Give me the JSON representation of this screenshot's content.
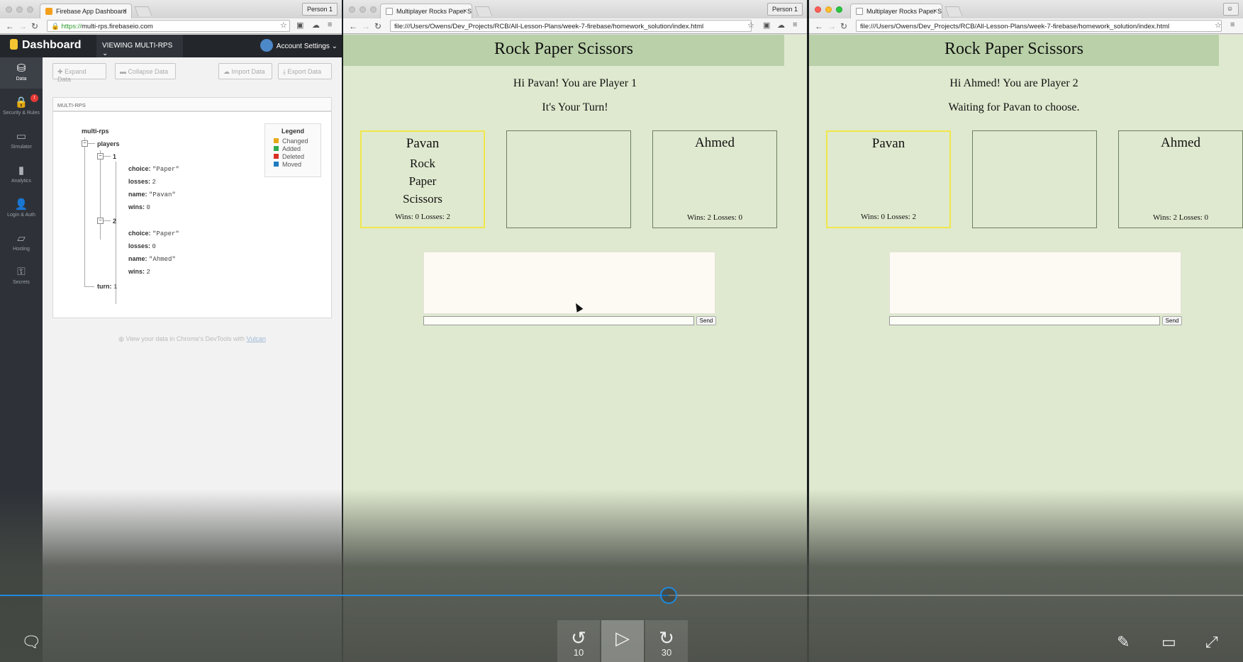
{
  "window1": {
    "tab_title": "Firebase App Dashboard",
    "person": "Person 1",
    "url_scheme": "https://",
    "url_rest": "multi-rps.firebaseio.com",
    "header": {
      "logo": "Dashboard",
      "viewing": "VIEWING MULTI-RPS",
      "account": "Account Settings"
    },
    "sidebar": [
      {
        "label": "Data",
        "icon": "database-icon"
      },
      {
        "label": "Security & Rules",
        "icon": "lock-icon",
        "badge": "!"
      },
      {
        "label": "Simulator",
        "icon": "laptop-icon"
      },
      {
        "label": "Analytics",
        "icon": "bar-chart-icon"
      },
      {
        "label": "Login & Auth",
        "icon": "user-icon"
      },
      {
        "label": "Hosting",
        "icon": "folder-icon"
      },
      {
        "label": "Secrets",
        "icon": "key-icon"
      }
    ],
    "toolbar": {
      "expand": "Expand Data",
      "collapse": "Collapse Data",
      "import": "Import Data",
      "export": "Export Data"
    },
    "breadcrumb": "MULTI-RPS",
    "tree": {
      "root": "multi-rps",
      "players": "players",
      "p1": {
        "key": "1",
        "choice_k": "choice:",
        "choice_v": "\"Paper\"",
        "losses_k": "losses:",
        "losses_v": "2",
        "name_k": "name:",
        "name_v": "\"Pavan\"",
        "wins_k": "wins:",
        "wins_v": "0"
      },
      "p2": {
        "key": "2",
        "choice_k": "choice:",
        "choice_v": "\"Paper\"",
        "losses_k": "losses:",
        "losses_v": "0",
        "name_k": "name:",
        "name_v": "\"Ahmed\"",
        "wins_k": "wins:",
        "wins_v": "2"
      },
      "turn_k": "turn:",
      "turn_v": "1"
    },
    "legend": {
      "title": "Legend",
      "items": [
        {
          "label": "Changed",
          "color": "#e6a817"
        },
        {
          "label": "Added",
          "color": "#2eaa4f"
        },
        {
          "label": "Deleted",
          "color": "#d93025"
        },
        {
          "label": "Moved",
          "color": "#1f7bbf"
        }
      ]
    },
    "vulcan_text": "View your data in Chrome's DevTools with",
    "vulcan_link": "Vulcan"
  },
  "window2": {
    "tab_title": "Multiplayer Rocks Paper Sc",
    "person": "Person 1",
    "url": "file:///Users/Owens/Dev_Projects/RCB/All-Lesson-Plans/week-7-firebase/homework_solution/index.html",
    "title": "Rock Paper Scissors",
    "greeting": "Hi Pavan! You are Player 1",
    "status": "It's Your Turn!",
    "player1": {
      "name": "Pavan",
      "choices": [
        "Rock",
        "Paper",
        "Scissors"
      ],
      "stats": "Wins: 0 Losses: 2"
    },
    "player2": {
      "name": "Ahmed",
      "stats": "Wins: 2 Losses: 0"
    },
    "send": "Send"
  },
  "window3": {
    "tab_title": "Multiplayer Rocks Paper Sc",
    "url": "file:///Users/Owens/Dev_Projects/RCB/All-Lesson-Plans/week-7-firebase/homework_solution/index.html",
    "title": "Rock Paper Scissors",
    "greeting": "Hi Ahmed! You are Player 2",
    "status": "Waiting for Pavan to choose.",
    "player1": {
      "name": "Pavan",
      "stats": "Wins: 0 Losses: 2"
    },
    "player2": {
      "name": "Ahmed",
      "stats": "Wins: 2 Losses: 0"
    },
    "send": "Send"
  },
  "video": {
    "progress": 0.538,
    "skip_back": "10",
    "skip_forward": "30",
    "accent": "#1f8be0"
  }
}
